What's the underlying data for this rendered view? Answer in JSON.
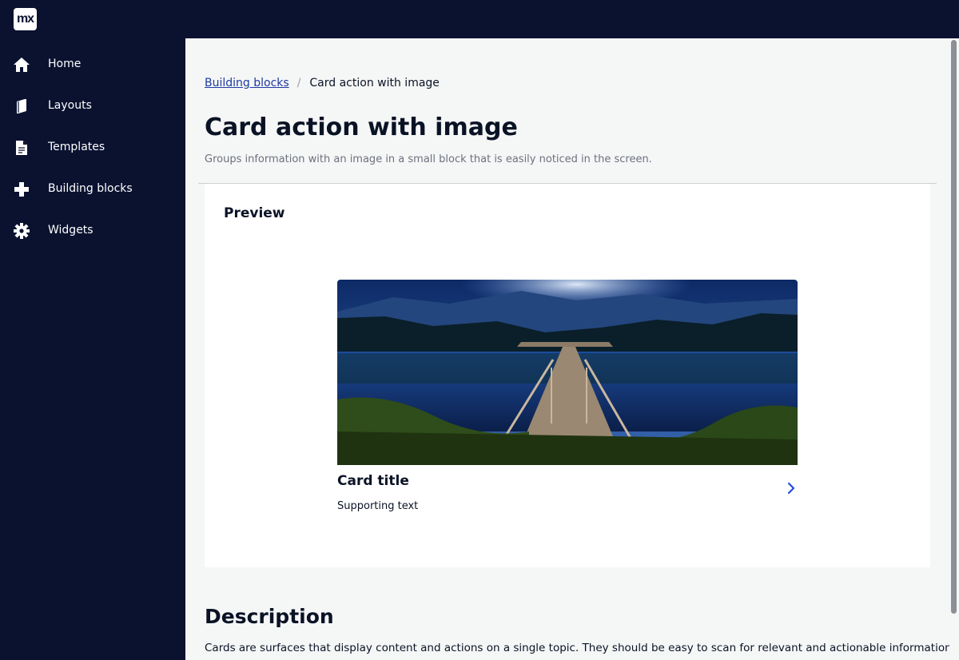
{
  "app": {
    "logo_text": "mx"
  },
  "sidebar": {
    "items": [
      {
        "label": "Home",
        "icon": "home-icon"
      },
      {
        "label": "Layouts",
        "icon": "layouts-icon"
      },
      {
        "label": "Templates",
        "icon": "document-icon"
      },
      {
        "label": "Building blocks",
        "icon": "plus-icon"
      },
      {
        "label": "Widgets",
        "icon": "gear-icon"
      }
    ]
  },
  "breadcrumb": {
    "parent": "Building blocks",
    "current": "Card action with image"
  },
  "page": {
    "title": "Card action with image",
    "subtitle": "Groups information with an image in a small block that is easily noticed in the screen."
  },
  "preview": {
    "heading": "Preview",
    "card": {
      "image": "lake-dock-night-image",
      "title": "Card title",
      "supporting_text": "Supporting text",
      "action_icon": "chevron-right-icon"
    }
  },
  "description": {
    "heading": "Description",
    "text": "Cards are surfaces that display content and actions on a single topic. They should be easy to scan for relevant and actionable information."
  },
  "colors": {
    "nav_bg": "#0a1230",
    "accent": "#264ae5",
    "page_bg": "#f5f6f6"
  }
}
